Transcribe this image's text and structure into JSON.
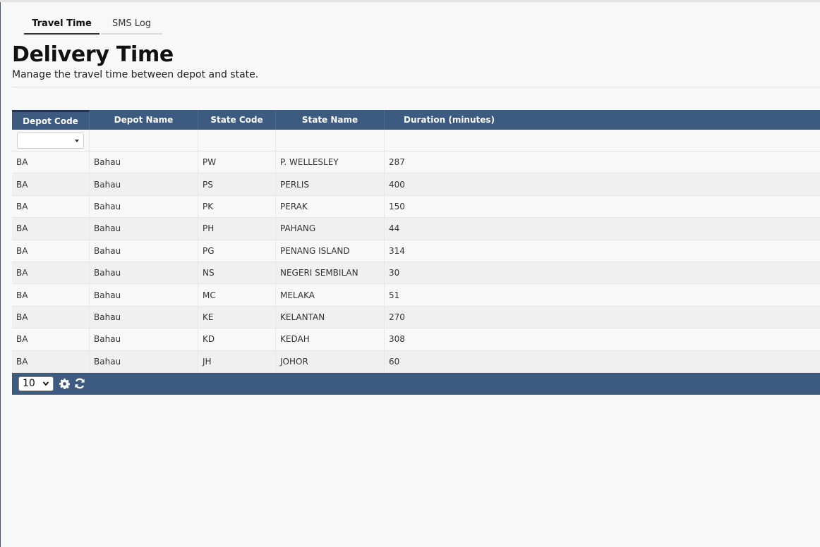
{
  "tabs": [
    {
      "label": "Travel Time",
      "active": true
    },
    {
      "label": "SMS Log",
      "active": false
    }
  ],
  "page": {
    "title": "Delivery Time",
    "subtitle": "Manage the travel time between depot and state."
  },
  "grid": {
    "columns": [
      "Depot Code",
      "Depot Name",
      "State Code",
      "State Name",
      "Duration (minutes)"
    ],
    "filter": {
      "depot_code": ""
    },
    "rows": [
      [
        "BA",
        "Bahau",
        "PW",
        "P. WELLESLEY",
        "287"
      ],
      [
        "BA",
        "Bahau",
        "PS",
        "PERLIS",
        "400"
      ],
      [
        "BA",
        "Bahau",
        "PK",
        "PERAK",
        "150"
      ],
      [
        "BA",
        "Bahau",
        "PH",
        "PAHANG",
        "44"
      ],
      [
        "BA",
        "Bahau",
        "PG",
        "PENANG ISLAND",
        "314"
      ],
      [
        "BA",
        "Bahau",
        "NS",
        "NEGERI SEMBILAN",
        "30"
      ],
      [
        "BA",
        "Bahau",
        "MC",
        "MELAKA",
        "51"
      ],
      [
        "BA",
        "Bahau",
        "KE",
        "KELANTAN",
        "270"
      ],
      [
        "BA",
        "Bahau",
        "KD",
        "KEDAH",
        "308"
      ],
      [
        "BA",
        "Bahau",
        "JH",
        "JOHOR",
        "60"
      ]
    ],
    "footer": {
      "page_size": "10",
      "icons": [
        "gear-icon",
        "refresh-icon"
      ]
    }
  },
  "colors": {
    "header_bg": "#3d5a80",
    "page_bg": "#f8f8f8"
  }
}
